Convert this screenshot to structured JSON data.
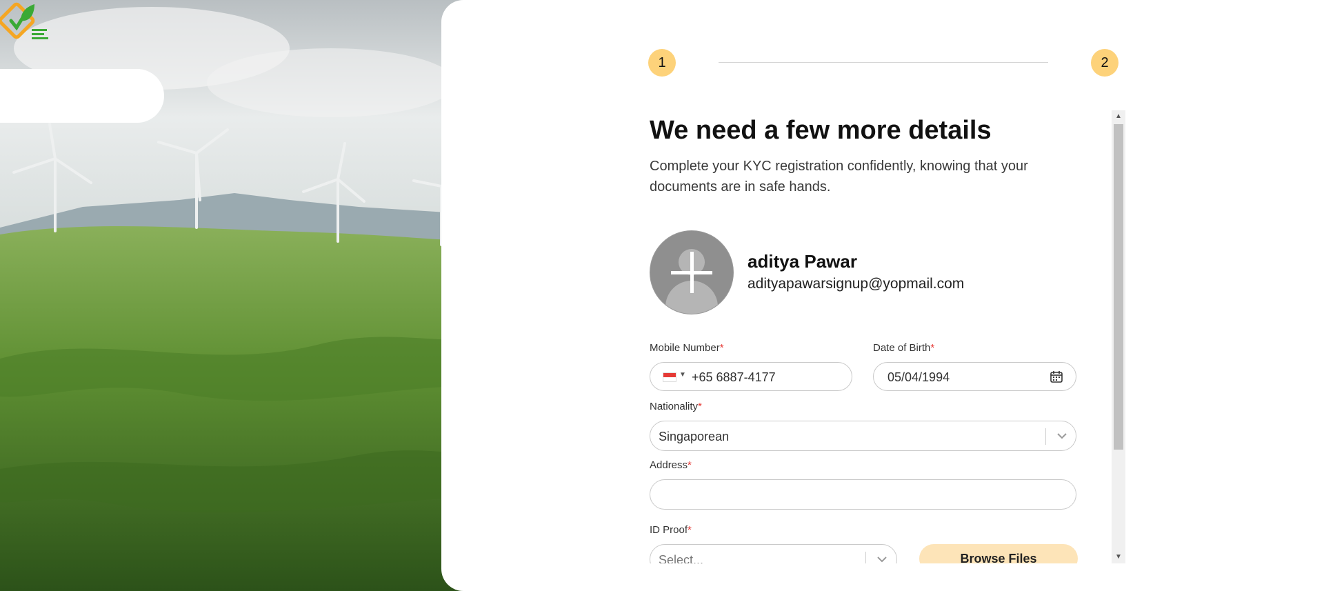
{
  "stepper": {
    "steps": [
      "1",
      "2"
    ],
    "color": "#fdd27a"
  },
  "header": {
    "title": "We need a few more details",
    "subtitle": "Complete your KYC registration confidently, knowing that your documents are in safe hands."
  },
  "profile": {
    "name": "aditya Pawar",
    "email": "adityapawarsignup@yopmail.com",
    "avatar_icon": "add-photo-icon"
  },
  "form": {
    "mobile": {
      "label": "Mobile Number",
      "required": "*",
      "value": "+65 6887-4177",
      "country_flag": "singapore-flag-icon"
    },
    "dob": {
      "label": "Date of Birth",
      "required": "*",
      "value": "05/04/1994",
      "icon": "calendar-icon"
    },
    "nationality": {
      "label": "Nationality",
      "required": "*",
      "value": "Singaporean"
    },
    "address": {
      "label": "Address",
      "required": "*",
      "value": ""
    },
    "id_proof": {
      "label": "ID Proof",
      "required": "*",
      "placeholder": "Select..."
    },
    "browse_label": "Browse Files"
  },
  "colors": {
    "accent": "#fdd27a",
    "browse_bg": "#fde4b8",
    "required": "#e53935"
  }
}
